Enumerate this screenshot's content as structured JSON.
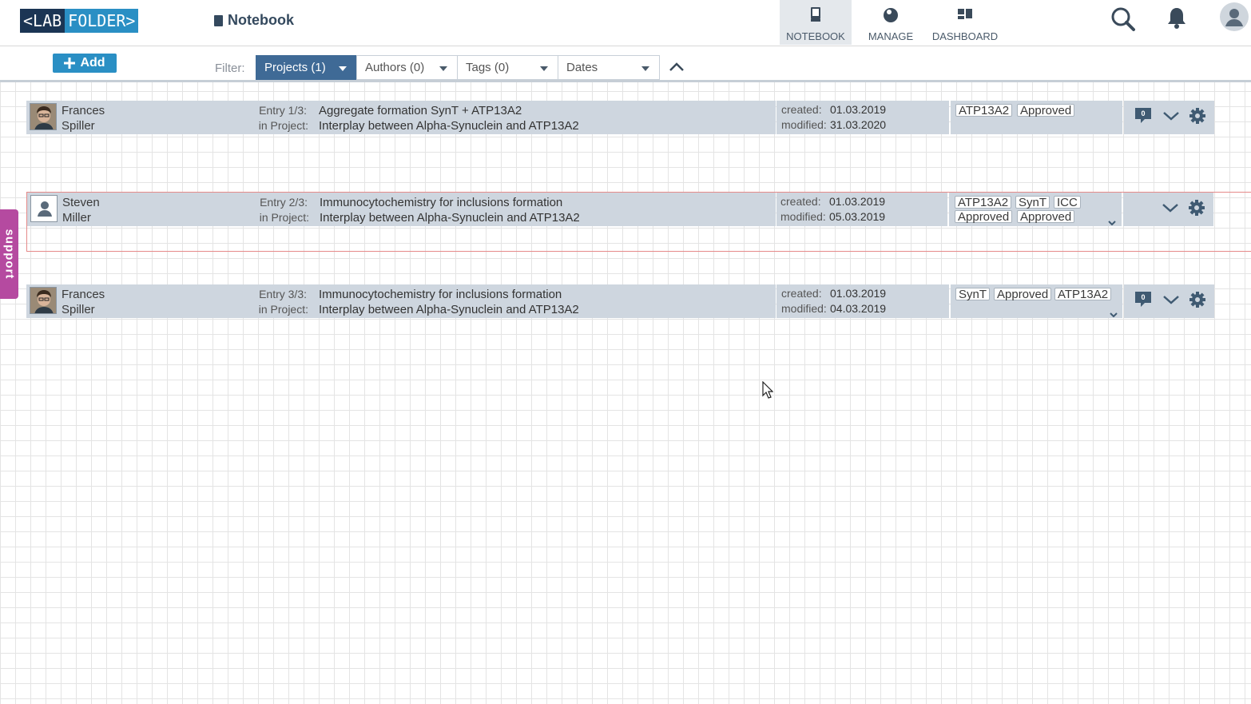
{
  "app": {
    "logo_left": "<LAB",
    "logo_right": "FOLDER>",
    "page_title": "Notebook"
  },
  "nav": [
    {
      "label": "NOTEBOOK",
      "icon": "notebook-icon",
      "active": true
    },
    {
      "label": "MANAGE",
      "icon": "manage-icon",
      "active": false
    },
    {
      "label": "DASHBOARD",
      "icon": "dashboard-icon",
      "active": false
    }
  ],
  "toolbar": {
    "add_label": "Add",
    "filter_label": "Filter:",
    "filters": [
      {
        "label": "Projects (1)",
        "active": true
      },
      {
        "label": "Authors (0)",
        "active": false
      },
      {
        "label": "Tags (0)",
        "active": false
      },
      {
        "label": "Dates",
        "active": false
      }
    ]
  },
  "support_label": "support",
  "labels": {
    "in_project": "in Project:",
    "created": "created:",
    "modified": "modified:"
  },
  "entries": [
    {
      "author_first": "Frances",
      "author_last": "Spiller",
      "avatar": "photo",
      "entry_label": "Entry 1/3:",
      "title": "Aggregate formation SynT + ATP13A2",
      "project": "Interplay between Alpha-Synuclein and ATP13A2",
      "created": "01.03.2019",
      "modified": "31.03.2020",
      "tags": [
        "ATP13A2",
        "Approved"
      ],
      "comments": "0",
      "selected": false
    },
    {
      "author_first": "Steven",
      "author_last": "Miller",
      "avatar": "placeholder",
      "entry_label": "Entry 2/3:",
      "title": "Immunocytochemistry for inclusions formation",
      "project": "Interplay between Alpha-Synuclein and ATP13A2",
      "created": "01.03.2019",
      "modified": "05.03.2019",
      "tags": [
        "ATP13A2",
        "SynT",
        "ICC",
        "Approved",
        "Approved"
      ],
      "comments": "",
      "selected": true
    },
    {
      "author_first": "Frances",
      "author_last": "Spiller",
      "avatar": "photo",
      "entry_label": "Entry 3/3:",
      "title": "Immunocytochemistry for inclusions formation",
      "project": "Interplay between Alpha-Synuclein and ATP13A2",
      "created": "01.03.2019",
      "modified": "04.03.2019",
      "tags": [
        "SynT",
        "Approved",
        "ATP13A2"
      ],
      "comments": "0",
      "selected": false
    }
  ]
}
